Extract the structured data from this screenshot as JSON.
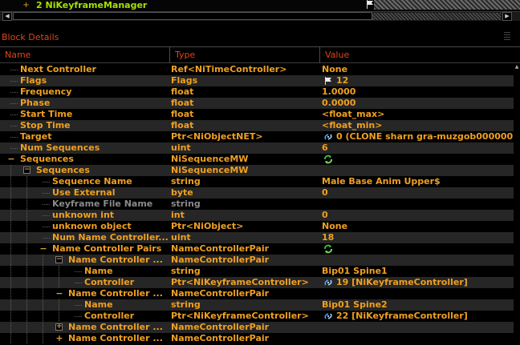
{
  "top_tree": {
    "item_label": "2 NiKeyframeManager",
    "expander_symbol": "+"
  },
  "panel": {
    "title": "Block Details"
  },
  "columns": {
    "name": "Name",
    "type": "Type",
    "value": "Value"
  },
  "rows": [
    {
      "name": "Next Controller",
      "type": "Ref<NiTimeController>",
      "value": "None",
      "depth": 1,
      "expander": "",
      "icon": ""
    },
    {
      "name": "Flags",
      "type": "Flags",
      "value": "12",
      "depth": 1,
      "expander": "",
      "icon": "flag-icon"
    },
    {
      "name": "Frequency",
      "type": "float",
      "value": "1.0000",
      "depth": 1,
      "expander": "",
      "icon": ""
    },
    {
      "name": "Phase",
      "type": "float",
      "value": "0.0000",
      "depth": 1,
      "expander": "",
      "icon": ""
    },
    {
      "name": "Start Time",
      "type": "float",
      "value": "<float_max>",
      "depth": 1,
      "expander": "",
      "icon": ""
    },
    {
      "name": "Stop Time",
      "type": "float",
      "value": "<float_min>",
      "depth": 1,
      "expander": "",
      "icon": ""
    },
    {
      "name": "Target",
      "type": "Ptr<NiObjectNET>",
      "value": "0 (CLONE sharn gra-muzgob000000",
      "depth": 1,
      "expander": "",
      "icon": "link-icon"
    },
    {
      "name": "Num Sequences",
      "type": "uint",
      "value": "6",
      "depth": 1,
      "expander": "",
      "icon": ""
    },
    {
      "name": "Sequences",
      "type": "NiSequenceMW",
      "value": "",
      "depth": 1,
      "expander": "−",
      "icon": "refresh-icon"
    },
    {
      "name": "Sequences",
      "type": "NiSequenceMW",
      "value": "",
      "depth": 2,
      "expander": "⊟",
      "icon": ""
    },
    {
      "name": "Sequence Name",
      "type": "string",
      "value": "Male Base Anim Upper$",
      "depth": 3,
      "expander": "",
      "icon": ""
    },
    {
      "name": "Use External",
      "type": "byte",
      "value": "0",
      "depth": 3,
      "expander": "",
      "icon": ""
    },
    {
      "name": "Keyframe File Name",
      "type": "string",
      "value": "",
      "depth": 3,
      "expander": "",
      "icon": "",
      "muted": true
    },
    {
      "name": "unknown int",
      "type": "int",
      "value": "0",
      "depth": 3,
      "expander": "",
      "icon": ""
    },
    {
      "name": "unknown object",
      "type": "Ptr<NiObject>",
      "value": "None",
      "depth": 3,
      "expander": "",
      "icon": ""
    },
    {
      "name": "Num Name Controller...",
      "type": "uint",
      "value": "18",
      "depth": 3,
      "expander": "",
      "icon": ""
    },
    {
      "name": "Name Controller Pairs",
      "type": "NameControllerPair",
      "value": "",
      "depth": 3,
      "expander": "−",
      "icon": "refresh-icon"
    },
    {
      "name": "Name Controller ...",
      "type": "NameControllerPair",
      "value": "",
      "depth": 4,
      "expander": "⊟",
      "icon": ""
    },
    {
      "name": "Name",
      "type": "string",
      "value": "Bip01 Spine1",
      "depth": 5,
      "expander": "",
      "icon": ""
    },
    {
      "name": "Controller",
      "type": "Ptr<NiKeyframeController>",
      "value": "19 [NiKeyframeController]",
      "depth": 5,
      "expander": "",
      "icon": "link-icon"
    },
    {
      "name": "Name Controller ...",
      "type": "NameControllerPair",
      "value": "",
      "depth": 4,
      "expander": "−",
      "icon": ""
    },
    {
      "name": "Name",
      "type": "string",
      "value": "Bip01 Spine2",
      "depth": 5,
      "expander": "",
      "icon": ""
    },
    {
      "name": "Controller",
      "type": "Ptr<NiKeyframeController>",
      "value": "22 [NiKeyframeController]",
      "depth": 5,
      "expander": "",
      "icon": "link-icon"
    },
    {
      "name": "Name Controller ...",
      "type": "NameControllerPair",
      "value": "",
      "depth": 4,
      "expander": "⊞",
      "icon": ""
    },
    {
      "name": "Name Controller ...",
      "type": "NameControllerPair",
      "value": "",
      "depth": 4,
      "expander": "+",
      "icon": ""
    }
  ]
}
